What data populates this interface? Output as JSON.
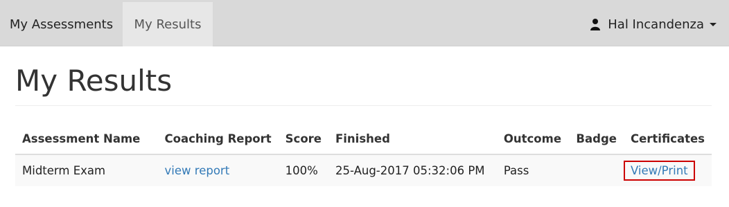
{
  "nav": {
    "tabs": [
      {
        "label": "My Assessments",
        "active": false
      },
      {
        "label": "My Results",
        "active": true
      }
    ],
    "user_name": "Hal Incandenza",
    "user_icon": "user-icon",
    "menu_icon": "caret-down-icon"
  },
  "page": {
    "title": "My Results"
  },
  "table": {
    "columns": [
      "Assessment Name",
      "Coaching Report",
      "Score",
      "Finished",
      "Outcome",
      "Badge",
      "Certificates"
    ],
    "rows": [
      {
        "assessment_name": "Midterm Exam",
        "coaching_report": "view report",
        "score": "100%",
        "finished": "25-Aug-2017 05:32:06 PM",
        "outcome": "Pass",
        "badge": "",
        "certificates": "View/Print"
      }
    ]
  },
  "colors": {
    "navbar_bg": "#d9d9d9",
    "active_tab_bg": "#e7e7e7",
    "link": "#337ab7",
    "highlight_box": "#cc0000"
  }
}
